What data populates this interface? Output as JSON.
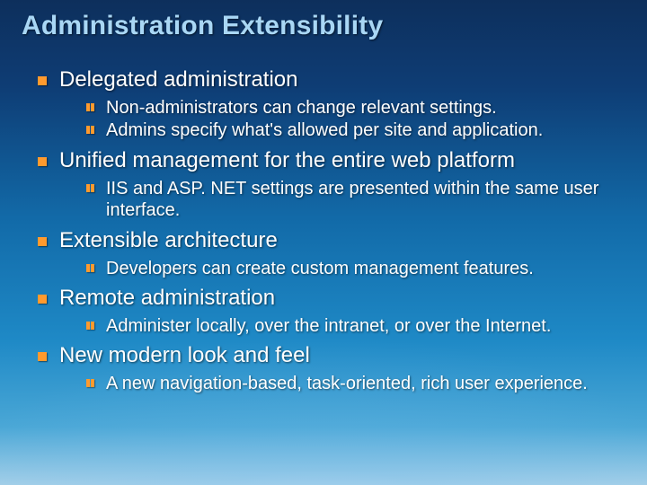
{
  "title": "Administration Extensibility",
  "bullets": [
    {
      "text": "Delegated administration",
      "sub": [
        "Non-administrators can change relevant settings.",
        "Admins specify what's allowed per site and application."
      ]
    },
    {
      "text": "Unified management for the entire web platform",
      "sub": [
        "IIS and ASP. NET settings are presented within the same user interface."
      ]
    },
    {
      "text": "Extensible architecture",
      "sub": [
        "Developers can create custom management features."
      ]
    },
    {
      "text": "Remote administration",
      "sub": [
        "Administer locally, over the intranet, or over the Internet."
      ]
    },
    {
      "text": "New modern look and feel",
      "sub": [
        "A new navigation-based, task-oriented, rich user experience."
      ]
    }
  ]
}
